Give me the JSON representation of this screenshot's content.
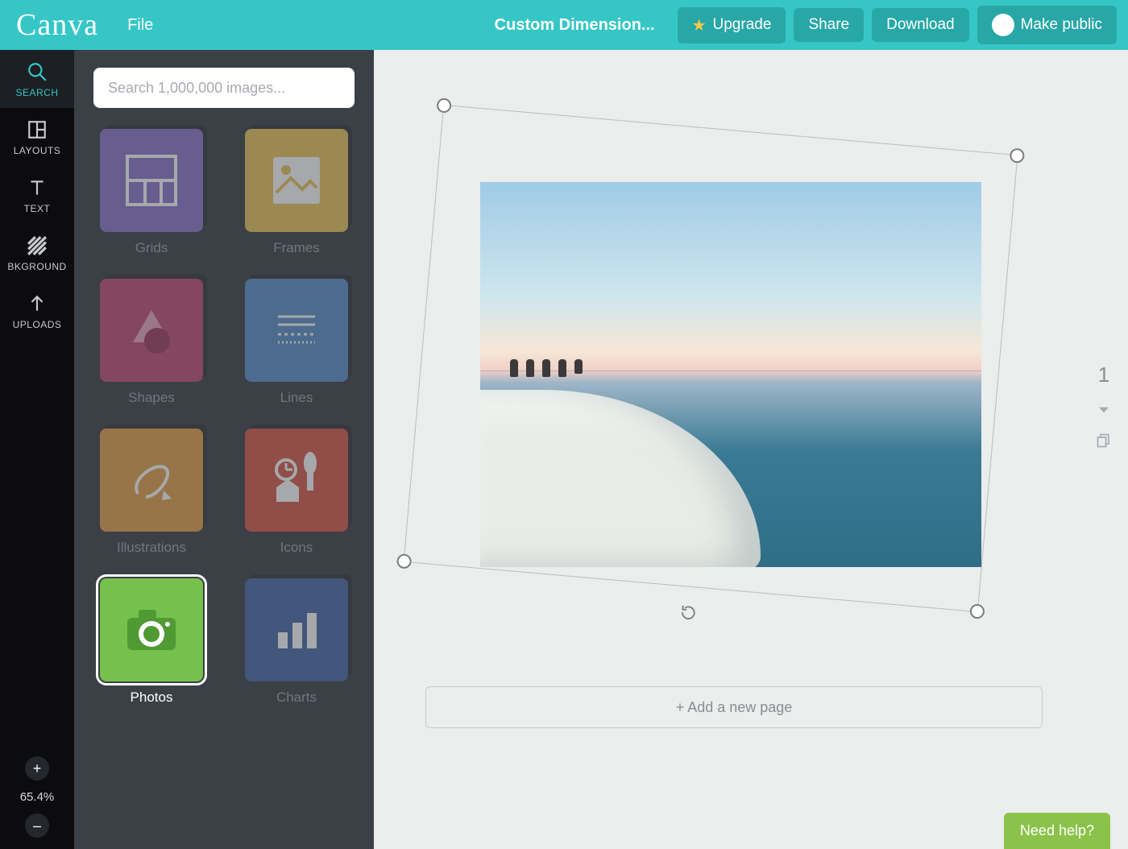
{
  "header": {
    "logo": "Canva",
    "file_menu": "File",
    "doc_title": "Custom Dimension...",
    "upgrade": "Upgrade",
    "share": "Share",
    "download": "Download",
    "make_public": "Make public"
  },
  "rail": {
    "items": [
      {
        "id": "search",
        "label": "SEARCH"
      },
      {
        "id": "layouts",
        "label": "LAYOUTS"
      },
      {
        "id": "text",
        "label": "TEXT"
      },
      {
        "id": "bkground",
        "label": "BKGROUND"
      },
      {
        "id": "uploads",
        "label": "UPLOADS"
      }
    ],
    "active": "search"
  },
  "zoom": {
    "value": "65.4%"
  },
  "panel": {
    "search_placeholder": "Search 1,000,000 images...",
    "categories": [
      {
        "id": "grids",
        "label": "Grids"
      },
      {
        "id": "frames",
        "label": "Frames"
      },
      {
        "id": "shapes",
        "label": "Shapes"
      },
      {
        "id": "lines",
        "label": "Lines"
      },
      {
        "id": "illus",
        "label": "Illustrations"
      },
      {
        "id": "icons",
        "label": "Icons"
      },
      {
        "id": "photos",
        "label": "Photos"
      },
      {
        "id": "charts",
        "label": "Charts"
      }
    ],
    "selected": "photos"
  },
  "canvas": {
    "page_number": "1",
    "add_page_label": "+ Add a new page"
  },
  "help": {
    "label": "Need help?"
  }
}
